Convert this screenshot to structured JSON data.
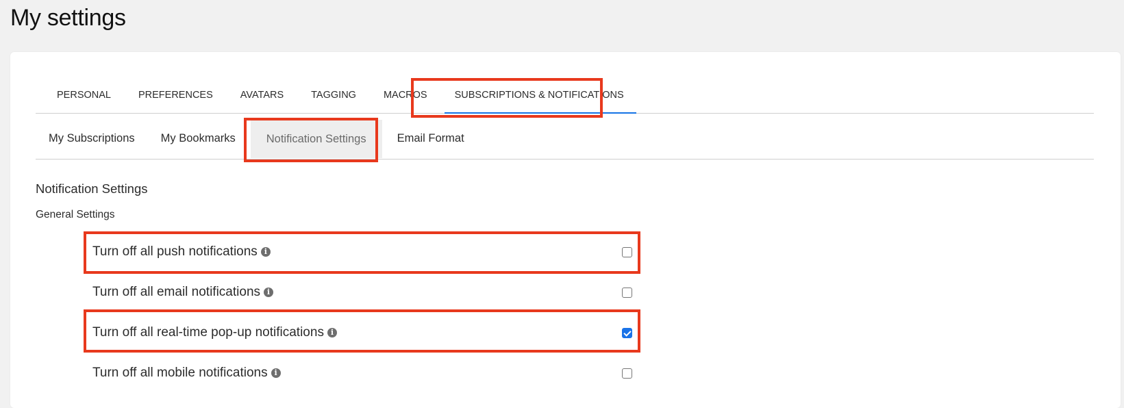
{
  "page_title": "My settings",
  "main_tabs": [
    {
      "label": "PERSONAL",
      "active": false
    },
    {
      "label": "PREFERENCES",
      "active": false
    },
    {
      "label": "AVATARS",
      "active": false
    },
    {
      "label": "TAGGING",
      "active": false
    },
    {
      "label": "MACROS",
      "active": false
    },
    {
      "label": "SUBSCRIPTIONS & NOTIFICATIONS",
      "active": true
    }
  ],
  "sub_tabs": [
    {
      "label": "My Subscriptions",
      "active": false
    },
    {
      "label": "My Bookmarks",
      "active": false
    },
    {
      "label": "Notification Settings",
      "active": true
    },
    {
      "label": "Email Format",
      "active": false
    }
  ],
  "section_heading": "Notification Settings",
  "section_subheading": "General Settings",
  "settings": [
    {
      "label": "Turn off all push notifications",
      "checked": false
    },
    {
      "label": "Turn off all email notifications",
      "checked": false
    },
    {
      "label": "Turn off all real-time pop-up notifications",
      "checked": true
    },
    {
      "label": "Turn off all mobile notifications",
      "checked": false
    }
  ],
  "icons": {
    "info": "info-icon"
  },
  "colors": {
    "accent": "#1473e6",
    "highlight": "#e8391d",
    "checkbox_checked": "#1a73e8"
  }
}
